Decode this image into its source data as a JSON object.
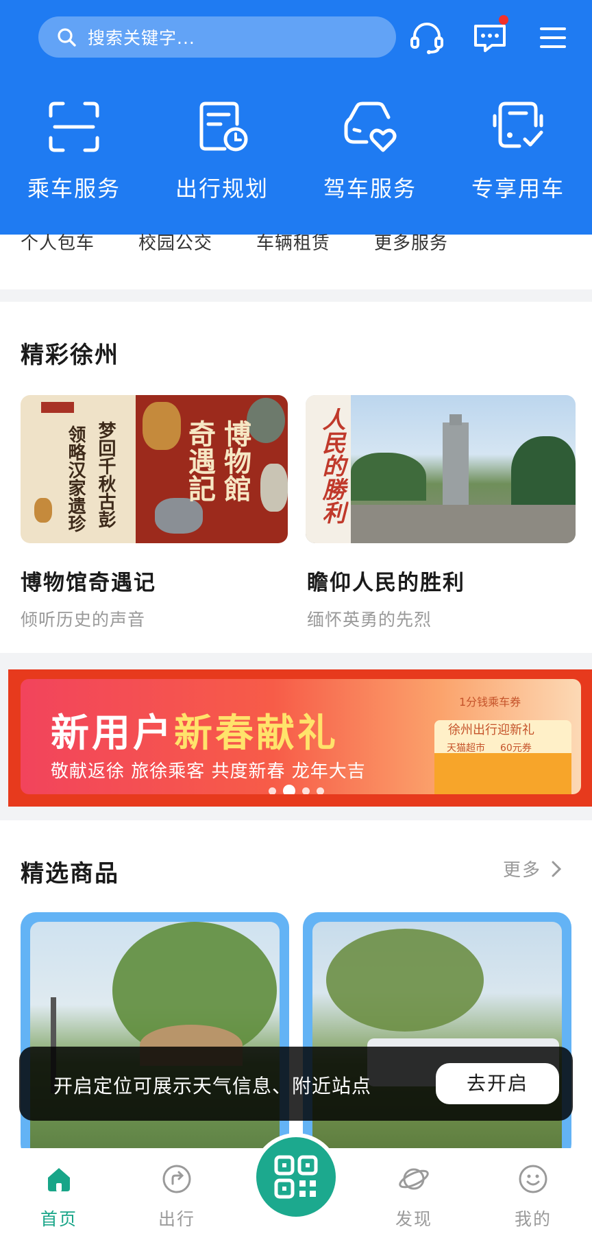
{
  "header": {
    "search_placeholder": "搜索关键字...",
    "accent": "#1f7bf2",
    "icons": [
      "search-icon",
      "headset-icon",
      "message-icon",
      "menu-icon"
    ]
  },
  "services": [
    {
      "label": "乘车服务",
      "icon": "scan-icon"
    },
    {
      "label": "出行规划",
      "icon": "plan-icon"
    },
    {
      "label": "驾车服务",
      "icon": "car-heart-icon"
    },
    {
      "label": "专享用车",
      "icon": "bus-check-icon"
    }
  ],
  "sub_services": [
    "个人包车",
    "校园公交",
    "车辆租赁",
    "更多服务"
  ],
  "highlights": {
    "title": "精彩徐州",
    "cards": [
      {
        "title": "博物馆奇遇记",
        "subtitle": "倾听历史的声音",
        "image_text": [
          "梦回千秋古彭",
          "领略汉家遗珍",
          "博物館",
          "奇遇記"
        ]
      },
      {
        "title": "瞻仰人民的胜利",
        "subtitle": "缅怀英勇的先烈",
        "image_text": [
          "人民的勝利"
        ]
      }
    ]
  },
  "banner": {
    "headline_white": "新用户",
    "headline_yellow": "新春献礼",
    "subline": "敬献返徐 旅徐乘客 共度新春 龙年大吉",
    "coupon_lines": [
      "1分钱乘车券",
      "徐州出行迎新礼",
      "天猫超市",
      "60元券"
    ],
    "active_dot": 1,
    "dot_count": 4
  },
  "products": {
    "title": "精选商品",
    "more_label": "更多"
  },
  "toast": {
    "message": "开启定位可展示天气信息、附近站点",
    "button_label": "去开启"
  },
  "tabbar": {
    "tabs": [
      {
        "label": "首页",
        "icon": "home-icon",
        "active": true
      },
      {
        "label": "出行",
        "icon": "route-icon",
        "active": false
      },
      {
        "label": "发现",
        "icon": "planet-icon",
        "active": false
      },
      {
        "label": "我的",
        "icon": "smile-icon",
        "active": false
      }
    ],
    "center_icon": "qr-code-icon",
    "active_color": "#18a588"
  }
}
